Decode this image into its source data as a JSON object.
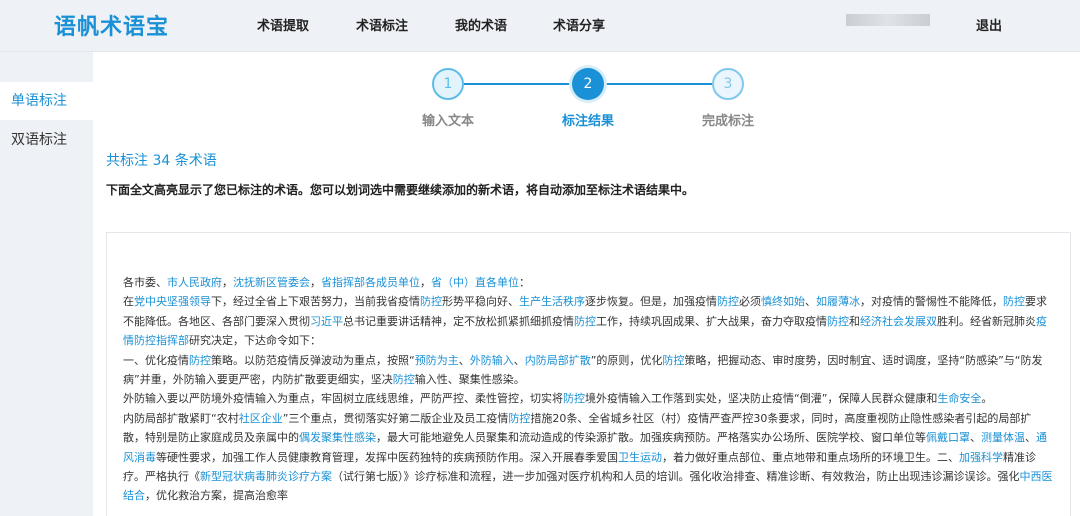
{
  "header": {
    "logo": "语帆术语宝",
    "nav": [
      "术语提取",
      "术语标注",
      "我的术语",
      "术语分享"
    ],
    "logout": "退出"
  },
  "sidebar": {
    "items": [
      {
        "label": "单语标注",
        "active": true
      },
      {
        "label": "双语标注",
        "active": false
      }
    ]
  },
  "steps": [
    {
      "num": "1",
      "label": "输入文本",
      "state": "done"
    },
    {
      "num": "2",
      "label": "标注结果",
      "state": "current"
    },
    {
      "num": "3",
      "label": "完成标注",
      "state": "todo"
    }
  ],
  "result": {
    "count_text": "共标注 34 条术语",
    "hint": "下面全文高亮显示了您已标注的术语。您可以划词选中需要继续添加的新术语，将自动添加至标注术语结果中。"
  },
  "colors": {
    "accent": "#1a91d6",
    "topbar_bg": "#eef1f5"
  },
  "document": {
    "paragraphs": [
      [
        {
          "t": "各市委、"
        },
        {
          "t": "市人民政府",
          "h": true
        },
        {
          "t": "，"
        },
        {
          "t": "沈抚新区管委会",
          "h": true
        },
        {
          "t": "，"
        },
        {
          "t": "省指挥部各成员单位",
          "h": true
        },
        {
          "t": "，"
        },
        {
          "t": "省（中）直各单位",
          "h": true
        },
        {
          "t": "："
        }
      ],
      [
        {
          "t": "在"
        },
        {
          "t": "党中央坚强领导",
          "h": true
        },
        {
          "t": "下，经过全省上下艰苦努力，当前我省疫情"
        },
        {
          "t": "防控",
          "h": true
        },
        {
          "t": "形势平稳向好、"
        },
        {
          "t": "生产生活秩序",
          "h": true
        },
        {
          "t": "逐步恢复。但是，加强疫情"
        },
        {
          "t": "防控",
          "h": true
        },
        {
          "t": "必须"
        },
        {
          "t": "慎终如始",
          "h": true
        },
        {
          "t": "、"
        },
        {
          "t": "如履薄冰",
          "h": true
        },
        {
          "t": "，对疫情的警惕性不能降低，"
        },
        {
          "t": "防控",
          "h": true
        },
        {
          "t": "要求不能降低。各地区、各部门要深入贯彻"
        },
        {
          "t": "习近平",
          "h": true
        },
        {
          "t": "总书记重要讲话精神，定不放松抓紧抓细抓疫情"
        },
        {
          "t": "防控",
          "h": true
        },
        {
          "t": "工作，持续巩固成果、扩大战果，奋力夺取疫情"
        },
        {
          "t": "防控",
          "h": true
        },
        {
          "t": "和"
        },
        {
          "t": "经济社会发展双",
          "h": true
        },
        {
          "t": "胜利。经省新冠肺炎"
        },
        {
          "t": "疫情防控指挥部",
          "h": true
        },
        {
          "t": "研究决定，下达命令如下："
        }
      ],
      [
        {
          "t": "一、优化疫情"
        },
        {
          "t": "防控",
          "h": true
        },
        {
          "t": "策略。以防范疫情反弹波动为重点，按照“"
        },
        {
          "t": "预防为主",
          "h": true
        },
        {
          "t": "、"
        },
        {
          "t": "外防输入",
          "h": true
        },
        {
          "t": "、"
        },
        {
          "t": "内防局部扩散",
          "h": true
        },
        {
          "t": "”的原则，优化"
        },
        {
          "t": "防控",
          "h": true
        },
        {
          "t": "策略，把握动态、审时度势，因时制宜、适时调度，坚持“防感染”与“防发病”并重，外防输入要更严密，内防扩散要更细实，坚决"
        },
        {
          "t": "防控",
          "h": true
        },
        {
          "t": "输入性、聚集性感染。"
        }
      ],
      [
        {
          "t": "外防输入要以严防境外疫情输入为重点，牢固树立底线思维，严防严控、柔性管控，切实将"
        },
        {
          "t": "防控",
          "h": true
        },
        {
          "t": "境外疫情输入工作落到实处，坚决防止疫情“倒灌”，保障人民群众健康和"
        },
        {
          "t": "生命安全",
          "h": true
        },
        {
          "t": "。"
        }
      ],
      [
        {
          "t": "内防局部扩散紧盯“农村"
        },
        {
          "t": "社区企业",
          "h": true
        },
        {
          "t": "”三个重点，贯彻落实好第二版企业及员工疫情"
        },
        {
          "t": "防控",
          "h": true
        },
        {
          "t": "措施20条、全省城乡社区（村）疫情严查严控30条要求，同时，高度重视防止隐性感染者引起的局部扩散，特别是防止家庭成员及亲属中的"
        },
        {
          "t": "偶发聚集性感染",
          "h": true
        },
        {
          "t": "，最大可能地避免人员聚集和流动造成的传染源扩散。加强疾病预防。严格落实办公场所、医院学校、窗口单位等"
        },
        {
          "t": "佩戴口罩",
          "h": true
        },
        {
          "t": "、"
        },
        {
          "t": "测量体温",
          "h": true
        },
        {
          "t": "、"
        },
        {
          "t": "通风消毒",
          "h": true
        },
        {
          "t": "等硬性要求，加强工作人员健康教育管理，发挥中医药独特的疾病预防作用。深入开展春季爱国"
        },
        {
          "t": "卫生运动",
          "h": true
        },
        {
          "t": "，着力做好重点部位、重点地带和重点场所的环境卫生。二、"
        },
        {
          "t": "加强科学",
          "h": true
        },
        {
          "t": "精准诊疗。严格执行《"
        },
        {
          "t": "新型冠状病毒肺炎诊疗方案",
          "h": true
        },
        {
          "t": "（试行第七版）》诊疗标准和流程，进一步加强对医疗机构和人员的培训。强化收治排查、精准诊断、有效救治，防止出现违诊漏诊误诊。强化"
        },
        {
          "t": "中西医结合",
          "h": true
        },
        {
          "t": "，优化救治方案，提高治愈率"
        }
      ]
    ]
  }
}
